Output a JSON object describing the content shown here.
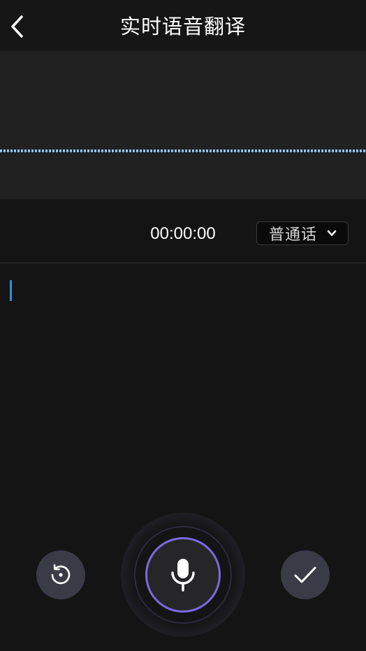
{
  "header": {
    "title": "实时语音翻译",
    "back_icon": "chevron-left-icon"
  },
  "recorder": {
    "timer": "00:00:00",
    "language": "普通话",
    "language_dropdown_icon": "chevron-down-icon"
  },
  "transcript": {
    "text": ""
  },
  "controls": {
    "reset_icon": "rotate-ccw-icon",
    "mic_icon": "microphone-icon",
    "confirm_icon": "check-icon"
  },
  "colors": {
    "background": "#141414",
    "header": "#161616",
    "wave_panel": "#212121",
    "waveform": "#8fc3ea",
    "caret": "#2d8ee0",
    "control_button": "#3b3a47",
    "mic_ring": "#7a6ae0"
  }
}
